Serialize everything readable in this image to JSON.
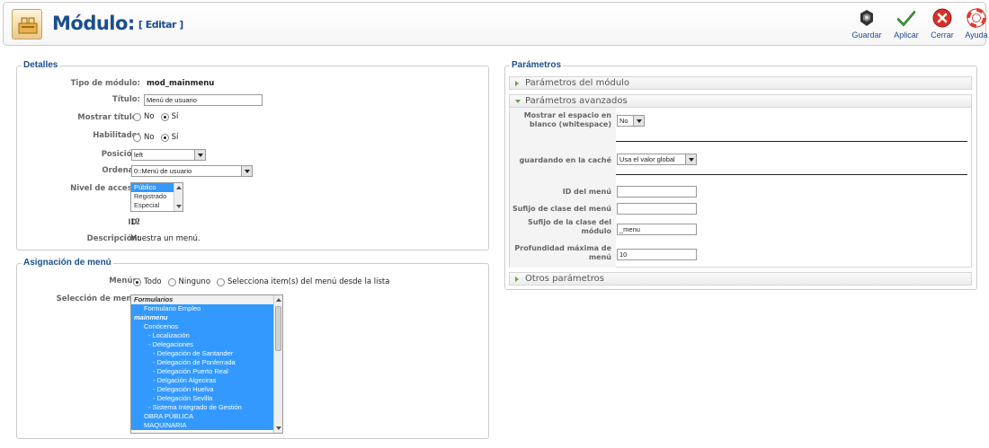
{
  "header": {
    "title": "Módulo:",
    "subtitle": "[ Editar ]",
    "buttons": [
      {
        "label": "Guardar",
        "icon": "save-icon"
      },
      {
        "label": "Aplicar",
        "icon": "apply-icon"
      },
      {
        "label": "Cerrar",
        "icon": "close-icon"
      },
      {
        "label": "Ayuda",
        "icon": "help-icon"
      }
    ]
  },
  "details": {
    "legend": "Detalles",
    "tipo_label": "Tipo de módulo:",
    "tipo_value": "mod_mainmenu",
    "titulo_label": "Título:",
    "titulo_value": "Menú de usuario",
    "mostrar_label": "Mostrar título:",
    "habilitado_label": "Habilitado:",
    "no_label": "No",
    "si_label": "Sí",
    "posicion_label": "Posición:",
    "posicion_value": "left",
    "ordenar_label": "Ordenar:",
    "ordenar_value": "0::Menú de usuario",
    "nivel_label": "Nivel de acceso:",
    "nivel_options": [
      "Público",
      "Registrado",
      "Especial"
    ],
    "id_label": "ID:",
    "id_value": "17",
    "desc_label": "Descripción:",
    "desc_value": "Muestra un menú."
  },
  "assignment": {
    "legend": "Asignación de menú",
    "menus_label": "Menús:",
    "opt_todo": "Todo",
    "opt_ninguno": "Ninguno",
    "opt_selecciona": "Selecciona item(s) del menú desde la lista",
    "seleccion_label": "Selección de menú:",
    "items": [
      "Formularios",
      "Formulario Empleo",
      "mainmenu",
      "Conócenos",
      "- Localización",
      "- Delegaciones",
      "- Delegación de Santander",
      "- Delegación de Ponferrada",
      "- Delegación Puerto Real",
      "- Delgación Algeciras",
      "- Delegación Huelva",
      "- Delegación Sevilla",
      "- Sistema Integrado de Gestión",
      "OBRA PÚBLICA",
      "MAQUINARIA"
    ]
  },
  "params": {
    "legend": "Parámetros",
    "module_params": "Parámetros del módulo",
    "advanced_params": "Parámetros avanzados",
    "other_params": "Otros parámetros",
    "whitespace_label": "Mostrar el espacio en blanco (whitespace)",
    "whitespace_value": "No",
    "cache_label": "guardando en la caché",
    "cache_value": "Usa el valor global",
    "menu_id_label": "ID del menú",
    "menu_id_value": "",
    "menu_class_label": "Sufijo de clase del menú",
    "menu_class_value": "",
    "module_class_label": "Sufijo de la clase del módulo",
    "module_class_value": "_menu",
    "depth_label": "Profundidad máxima de menú",
    "depth_value": "10"
  }
}
